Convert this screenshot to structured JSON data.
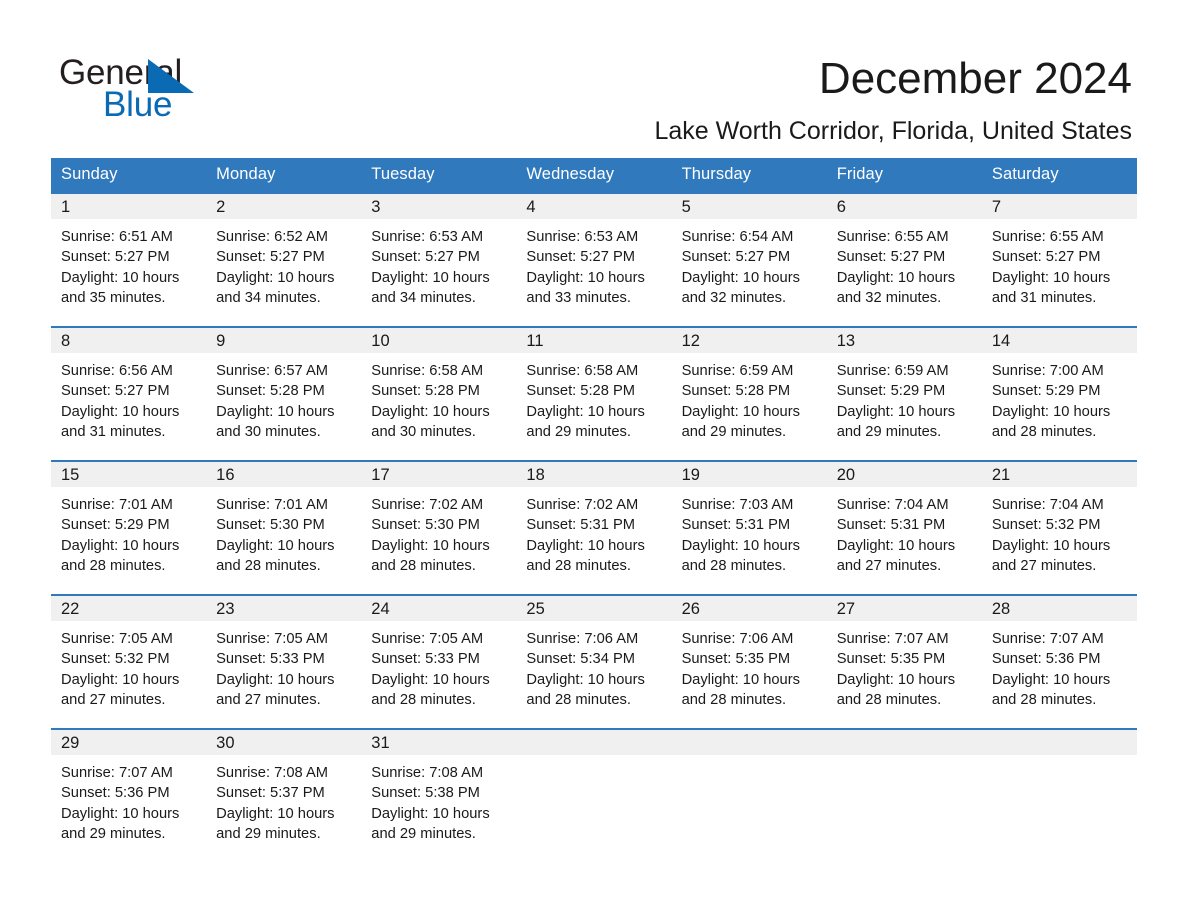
{
  "brand": {
    "name_part1": "General",
    "name_part2": "Blue",
    "logo_icon": "blue-triangle-logo",
    "colors": {
      "black": "#231f20",
      "blue": "#0a6ab4"
    }
  },
  "header": {
    "title": "December 2024",
    "subtitle": "Lake Worth Corridor, Florida, United States"
  },
  "theme": {
    "header_blue": "#3079bd",
    "daynum_band": "#f0f0f0",
    "text": "#1a1a1a"
  },
  "calendar": {
    "weekday_headers": [
      "Sunday",
      "Monday",
      "Tuesday",
      "Wednesday",
      "Thursday",
      "Friday",
      "Saturday"
    ],
    "labels": {
      "sunrise": "Sunrise:",
      "sunset": "Sunset:",
      "daylight": "Daylight:"
    },
    "weeks": [
      [
        {
          "day": "1",
          "sunrise": "Sunrise: 6:51 AM",
          "sunset": "Sunset: 5:27 PM",
          "daylight_line1": "Daylight: 10 hours",
          "daylight_line2": "and 35 minutes."
        },
        {
          "day": "2",
          "sunrise": "Sunrise: 6:52 AM",
          "sunset": "Sunset: 5:27 PM",
          "daylight_line1": "Daylight: 10 hours",
          "daylight_line2": "and 34 minutes."
        },
        {
          "day": "3",
          "sunrise": "Sunrise: 6:53 AM",
          "sunset": "Sunset: 5:27 PM",
          "daylight_line1": "Daylight: 10 hours",
          "daylight_line2": "and 34 minutes."
        },
        {
          "day": "4",
          "sunrise": "Sunrise: 6:53 AM",
          "sunset": "Sunset: 5:27 PM",
          "daylight_line1": "Daylight: 10 hours",
          "daylight_line2": "and 33 minutes."
        },
        {
          "day": "5",
          "sunrise": "Sunrise: 6:54 AM",
          "sunset": "Sunset: 5:27 PM",
          "daylight_line1": "Daylight: 10 hours",
          "daylight_line2": "and 32 minutes."
        },
        {
          "day": "6",
          "sunrise": "Sunrise: 6:55 AM",
          "sunset": "Sunset: 5:27 PM",
          "daylight_line1": "Daylight: 10 hours",
          "daylight_line2": "and 32 minutes."
        },
        {
          "day": "7",
          "sunrise": "Sunrise: 6:55 AM",
          "sunset": "Sunset: 5:27 PM",
          "daylight_line1": "Daylight: 10 hours",
          "daylight_line2": "and 31 minutes."
        }
      ],
      [
        {
          "day": "8",
          "sunrise": "Sunrise: 6:56 AM",
          "sunset": "Sunset: 5:27 PM",
          "daylight_line1": "Daylight: 10 hours",
          "daylight_line2": "and 31 minutes."
        },
        {
          "day": "9",
          "sunrise": "Sunrise: 6:57 AM",
          "sunset": "Sunset: 5:28 PM",
          "daylight_line1": "Daylight: 10 hours",
          "daylight_line2": "and 30 minutes."
        },
        {
          "day": "10",
          "sunrise": "Sunrise: 6:58 AM",
          "sunset": "Sunset: 5:28 PM",
          "daylight_line1": "Daylight: 10 hours",
          "daylight_line2": "and 30 minutes."
        },
        {
          "day": "11",
          "sunrise": "Sunrise: 6:58 AM",
          "sunset": "Sunset: 5:28 PM",
          "daylight_line1": "Daylight: 10 hours",
          "daylight_line2": "and 29 minutes."
        },
        {
          "day": "12",
          "sunrise": "Sunrise: 6:59 AM",
          "sunset": "Sunset: 5:28 PM",
          "daylight_line1": "Daylight: 10 hours",
          "daylight_line2": "and 29 minutes."
        },
        {
          "day": "13",
          "sunrise": "Sunrise: 6:59 AM",
          "sunset": "Sunset: 5:29 PM",
          "daylight_line1": "Daylight: 10 hours",
          "daylight_line2": "and 29 minutes."
        },
        {
          "day": "14",
          "sunrise": "Sunrise: 7:00 AM",
          "sunset": "Sunset: 5:29 PM",
          "daylight_line1": "Daylight: 10 hours",
          "daylight_line2": "and 28 minutes."
        }
      ],
      [
        {
          "day": "15",
          "sunrise": "Sunrise: 7:01 AM",
          "sunset": "Sunset: 5:29 PM",
          "daylight_line1": "Daylight: 10 hours",
          "daylight_line2": "and 28 minutes."
        },
        {
          "day": "16",
          "sunrise": "Sunrise: 7:01 AM",
          "sunset": "Sunset: 5:30 PM",
          "daylight_line1": "Daylight: 10 hours",
          "daylight_line2": "and 28 minutes."
        },
        {
          "day": "17",
          "sunrise": "Sunrise: 7:02 AM",
          "sunset": "Sunset: 5:30 PM",
          "daylight_line1": "Daylight: 10 hours",
          "daylight_line2": "and 28 minutes."
        },
        {
          "day": "18",
          "sunrise": "Sunrise: 7:02 AM",
          "sunset": "Sunset: 5:31 PM",
          "daylight_line1": "Daylight: 10 hours",
          "daylight_line2": "and 28 minutes."
        },
        {
          "day": "19",
          "sunrise": "Sunrise: 7:03 AM",
          "sunset": "Sunset: 5:31 PM",
          "daylight_line1": "Daylight: 10 hours",
          "daylight_line2": "and 28 minutes."
        },
        {
          "day": "20",
          "sunrise": "Sunrise: 7:04 AM",
          "sunset": "Sunset: 5:31 PM",
          "daylight_line1": "Daylight: 10 hours",
          "daylight_line2": "and 27 minutes."
        },
        {
          "day": "21",
          "sunrise": "Sunrise: 7:04 AM",
          "sunset": "Sunset: 5:32 PM",
          "daylight_line1": "Daylight: 10 hours",
          "daylight_line2": "and 27 minutes."
        }
      ],
      [
        {
          "day": "22",
          "sunrise": "Sunrise: 7:05 AM",
          "sunset": "Sunset: 5:32 PM",
          "daylight_line1": "Daylight: 10 hours",
          "daylight_line2": "and 27 minutes."
        },
        {
          "day": "23",
          "sunrise": "Sunrise: 7:05 AM",
          "sunset": "Sunset: 5:33 PM",
          "daylight_line1": "Daylight: 10 hours",
          "daylight_line2": "and 27 minutes."
        },
        {
          "day": "24",
          "sunrise": "Sunrise: 7:05 AM",
          "sunset": "Sunset: 5:33 PM",
          "daylight_line1": "Daylight: 10 hours",
          "daylight_line2": "and 28 minutes."
        },
        {
          "day": "25",
          "sunrise": "Sunrise: 7:06 AM",
          "sunset": "Sunset: 5:34 PM",
          "daylight_line1": "Daylight: 10 hours",
          "daylight_line2": "and 28 minutes."
        },
        {
          "day": "26",
          "sunrise": "Sunrise: 7:06 AM",
          "sunset": "Sunset: 5:35 PM",
          "daylight_line1": "Daylight: 10 hours",
          "daylight_line2": "and 28 minutes."
        },
        {
          "day": "27",
          "sunrise": "Sunrise: 7:07 AM",
          "sunset": "Sunset: 5:35 PM",
          "daylight_line1": "Daylight: 10 hours",
          "daylight_line2": "and 28 minutes."
        },
        {
          "day": "28",
          "sunrise": "Sunrise: 7:07 AM",
          "sunset": "Sunset: 5:36 PM",
          "daylight_line1": "Daylight: 10 hours",
          "daylight_line2": "and 28 minutes."
        }
      ],
      [
        {
          "day": "29",
          "sunrise": "Sunrise: 7:07 AM",
          "sunset": "Sunset: 5:36 PM",
          "daylight_line1": "Daylight: 10 hours",
          "daylight_line2": "and 29 minutes."
        },
        {
          "day": "30",
          "sunrise": "Sunrise: 7:08 AM",
          "sunset": "Sunset: 5:37 PM",
          "daylight_line1": "Daylight: 10 hours",
          "daylight_line2": "and 29 minutes."
        },
        {
          "day": "31",
          "sunrise": "Sunrise: 7:08 AM",
          "sunset": "Sunset: 5:38 PM",
          "daylight_line1": "Daylight: 10 hours",
          "daylight_line2": "and 29 minutes."
        },
        {
          "day": "",
          "sunrise": "",
          "sunset": "",
          "daylight_line1": "",
          "daylight_line2": ""
        },
        {
          "day": "",
          "sunrise": "",
          "sunset": "",
          "daylight_line1": "",
          "daylight_line2": ""
        },
        {
          "day": "",
          "sunrise": "",
          "sunset": "",
          "daylight_line1": "",
          "daylight_line2": ""
        },
        {
          "day": "",
          "sunrise": "",
          "sunset": "",
          "daylight_line1": "",
          "daylight_line2": ""
        }
      ]
    ]
  }
}
